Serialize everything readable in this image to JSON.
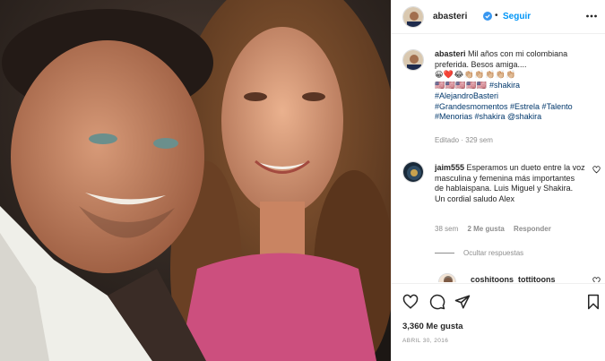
{
  "post": {
    "username": "abasteri",
    "follow_label": "Seguir",
    "separator": "•"
  },
  "caption": {
    "username": "abasteri",
    "text": "Mil años con mi colombiana preferida. Besos amiga....",
    "emojis": "😀❤️😂👏🏼👏🏼👏🏼👏🏼👏🏼",
    "emojis2": "🇺🇸🇺🇸🇺🇸🇺🇸🇺🇸",
    "hashtags_line1_tag": "#shakira",
    "hashtags_line2": "#AlejandroBasteri",
    "hashtags_line3": "#Grandesmomentos #Estrela #Talento",
    "hashtags_line4": "#Menorias #shakira @shakira",
    "meta": "Editado · 329 sem"
  },
  "comment": {
    "username": "jaim555",
    "text": "Esperamos un dueto entre la voz masculina y femenina más importantes de hablaispana. Luis Miguel y Shakira. Un cordial saludo Alex",
    "age": "38 sem",
    "likes": "2 Me gusta",
    "reply_label": "Responder",
    "hide_replies": "Ocultar respuestas"
  },
  "reply": {
    "username": "coshitoons_tottitoons"
  },
  "footer": {
    "likes": "3,360 Me gusta",
    "date": "ABRIL 30, 2016"
  },
  "icons": {
    "more": "more-options-icon",
    "verified": "verified-badge-icon",
    "like": "heart-icon",
    "comment": "comment-icon",
    "share": "share-icon",
    "save": "bookmark-icon"
  },
  "colors": {
    "link": "#00376b",
    "follow": "#0095f6",
    "muted": "#8e8e8e",
    "text": "#262626",
    "border": "#efefef"
  }
}
